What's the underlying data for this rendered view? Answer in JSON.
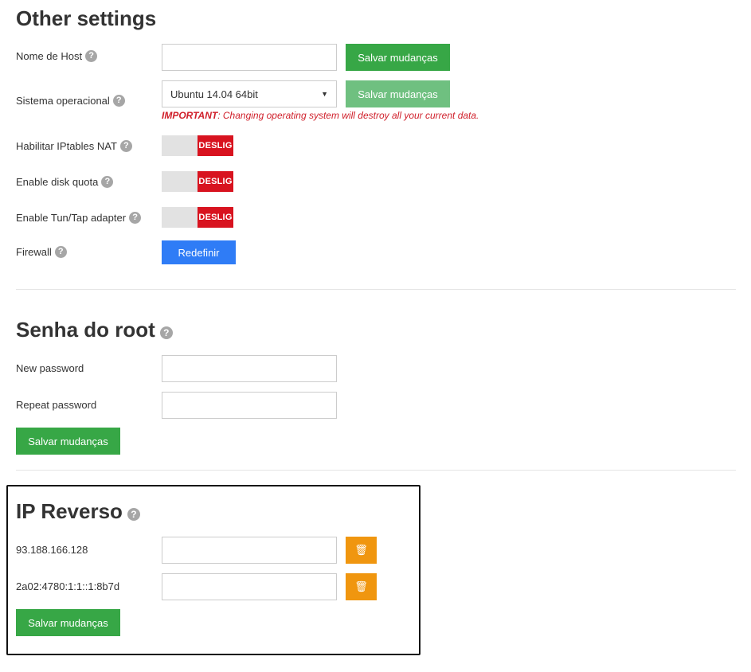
{
  "other_settings": {
    "title": "Other settings",
    "hostname": {
      "label": "Nome de Host",
      "value": "",
      "save_label": "Salvar mudanças"
    },
    "os": {
      "label": "Sistema operacional",
      "selected": "Ubuntu 14.04 64bit",
      "save_label": "Salvar mudanças",
      "warning_strong": "IMPORTANT",
      "warning_text": ": Changing operating system will destroy all your current data."
    },
    "iptables_nat": {
      "label": "Habilitar IPtables NAT",
      "state": "DESLIG"
    },
    "disk_quota": {
      "label": "Enable disk quota",
      "state": "DESLIG"
    },
    "tun_tap": {
      "label": "Enable Tun/Tap adapter",
      "state": "DESLIG"
    },
    "firewall": {
      "label": "Firewall",
      "button_label": "Redefinir"
    }
  },
  "root_password": {
    "title": "Senha do root",
    "new_password_label": "New password",
    "repeat_password_label": "Repeat password",
    "save_label": "Salvar mudanças"
  },
  "reverse_ip": {
    "title": "IP Reverso",
    "entries": [
      {
        "ip": "93.188.166.128",
        "value": ""
      },
      {
        "ip": "2a02:4780:1:1::1:8b7d",
        "value": ""
      }
    ],
    "save_label": "Salvar mudanças"
  },
  "help_glyph": "?",
  "trash_glyph": "🗑",
  "colors": {
    "green": "#37a746",
    "green_disabled": "#6fc080",
    "blue": "#2f7cf6",
    "orange": "#f0960f",
    "red_toggle": "#d8131f",
    "warning_red": "#d0202b"
  }
}
